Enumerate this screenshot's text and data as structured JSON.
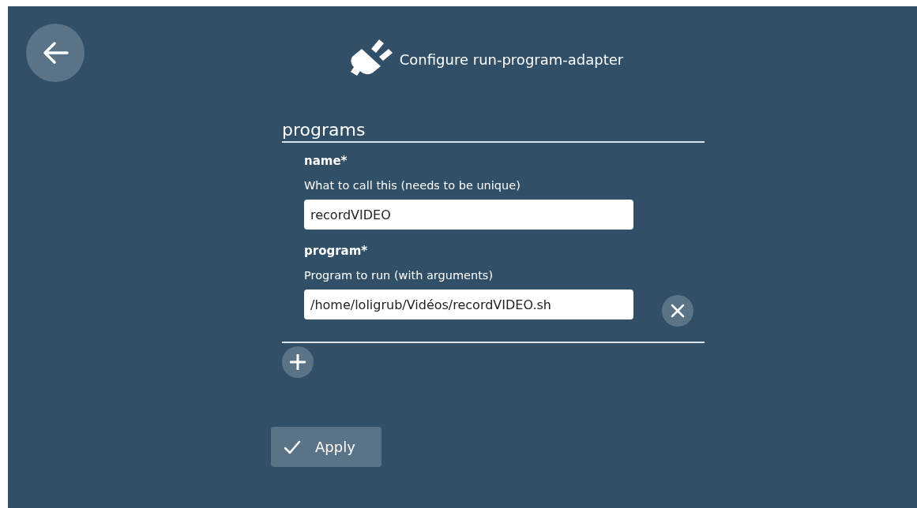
{
  "header": {
    "title": "Configure run-program-adapter"
  },
  "section": {
    "title": "programs",
    "fields": [
      {
        "label": "name*",
        "hint": "What to call this (needs to be unique)",
        "value": "recordVIDEO"
      },
      {
        "label": "program*",
        "hint": "Program to run (with arguments)",
        "value": "/home/loligrub/Vidéos/recordVIDEO.sh"
      }
    ]
  },
  "apply": {
    "label": "Apply"
  }
}
